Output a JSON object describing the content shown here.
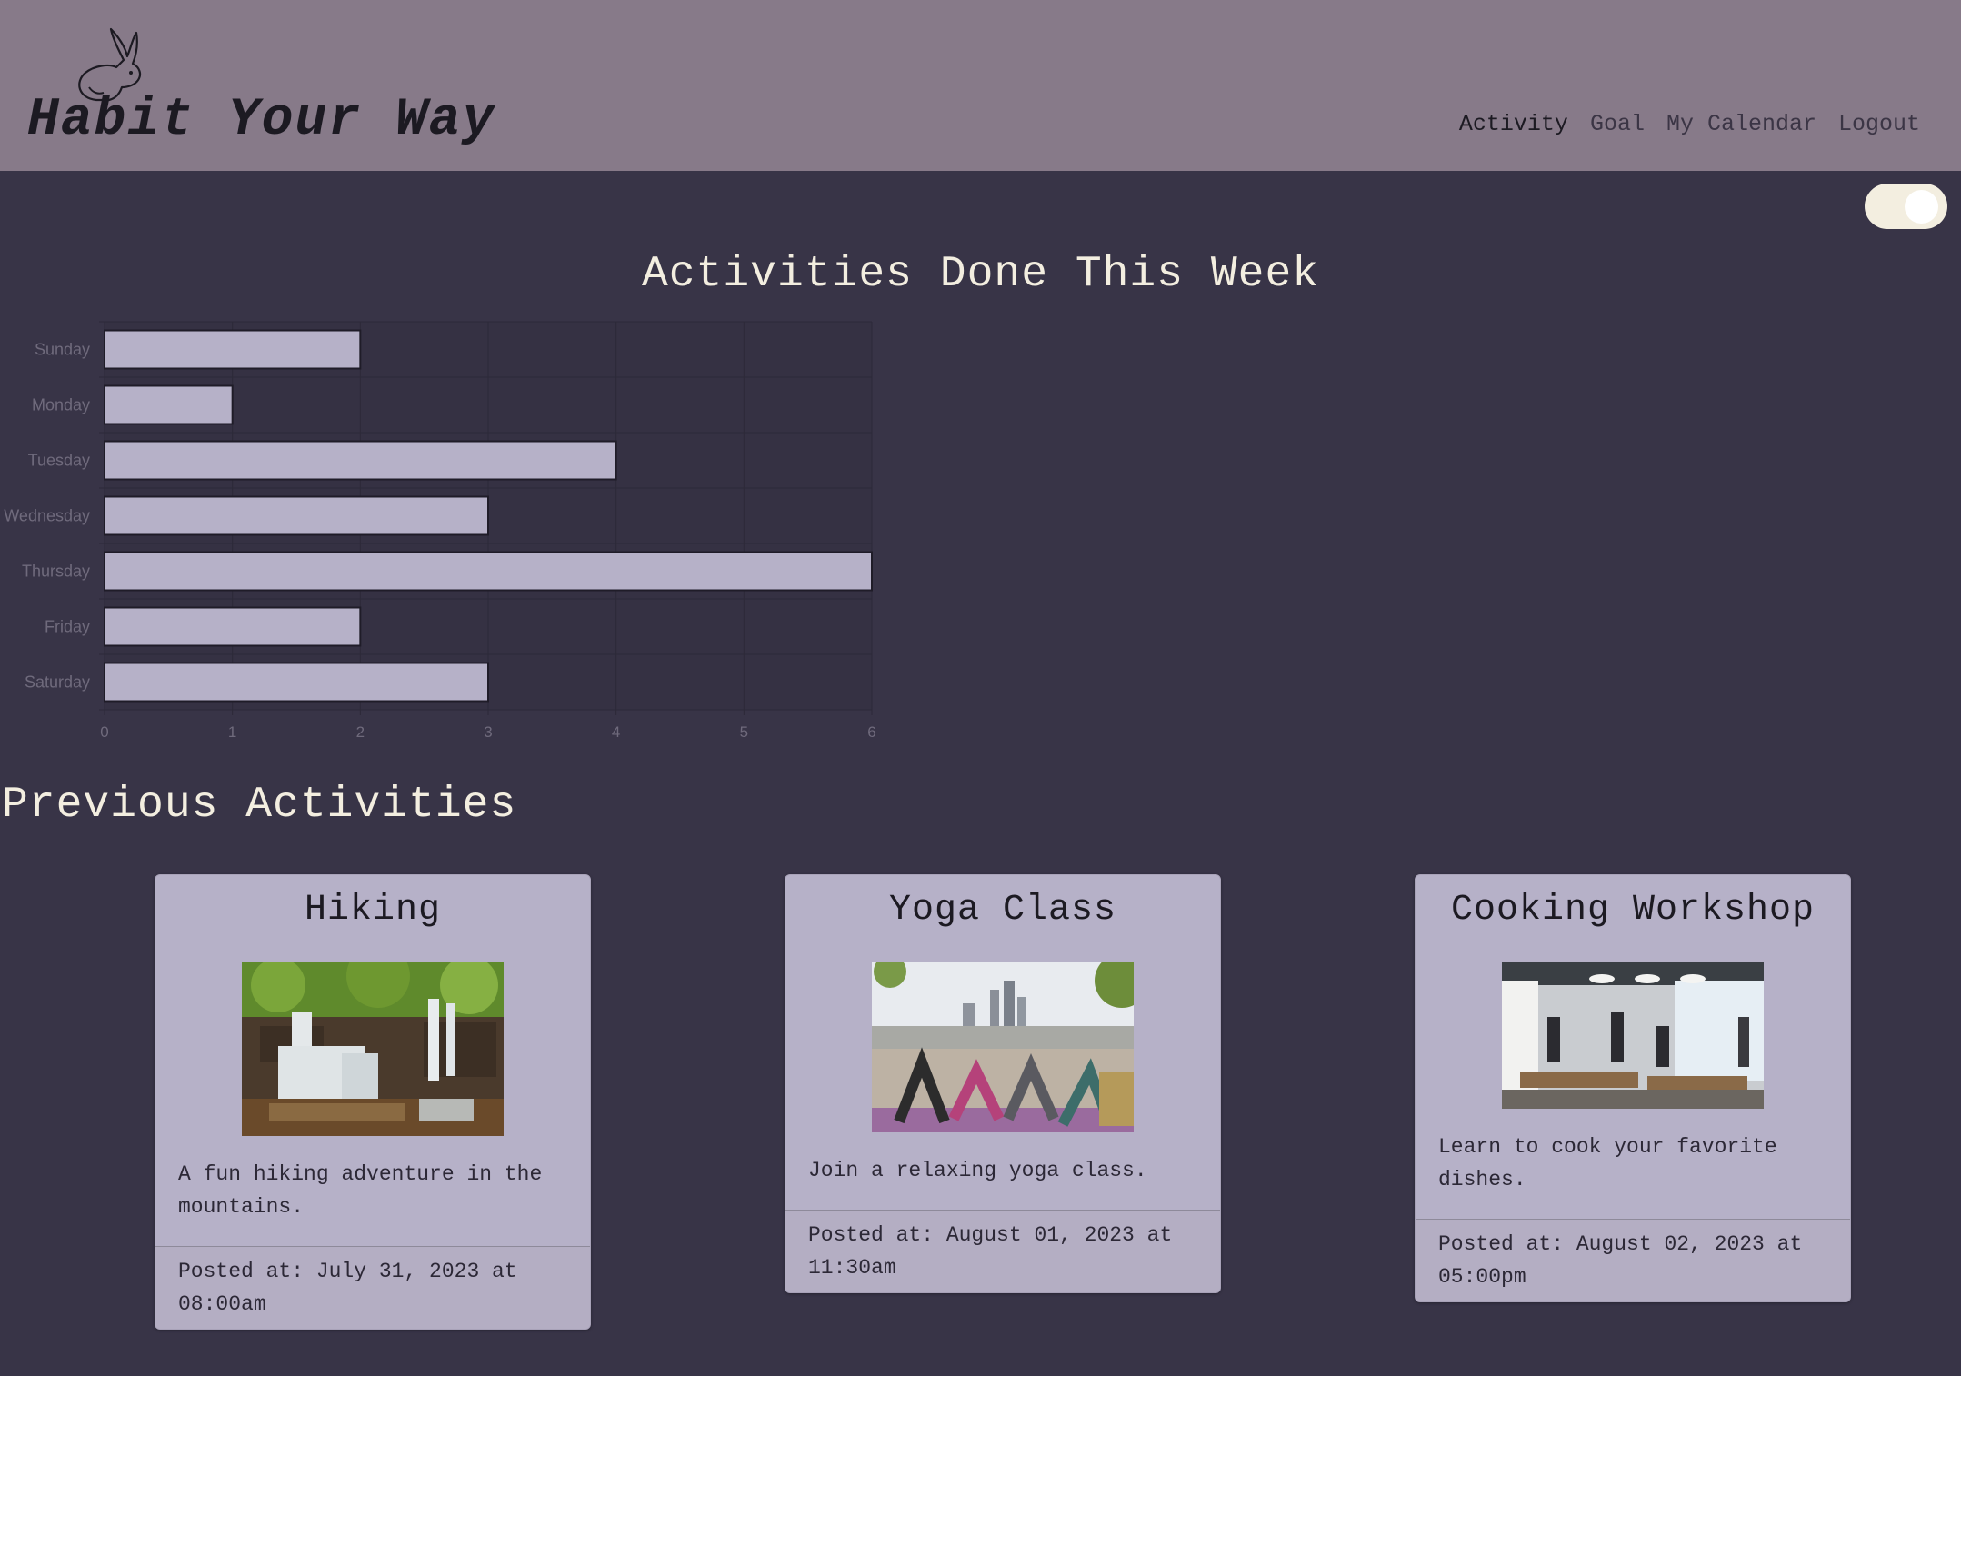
{
  "header": {
    "brand": "Habit Your Way",
    "nav": [
      {
        "label": "Activity"
      },
      {
        "label": "Goal"
      },
      {
        "label": "My Calendar"
      },
      {
        "label": "Logout"
      }
    ]
  },
  "theme_toggle": {
    "state": "on"
  },
  "chart_section": {
    "title": "Activities Done This Week"
  },
  "chart_data": {
    "type": "bar",
    "orientation": "horizontal",
    "categories": [
      "Sunday",
      "Monday",
      "Tuesday",
      "Wednesday",
      "Thursday",
      "Friday",
      "Saturday"
    ],
    "values": [
      2,
      1,
      4,
      3,
      6,
      2,
      3
    ],
    "xlim": [
      0,
      6
    ],
    "x_ticks": [
      0,
      1,
      2,
      3,
      4,
      5,
      6
    ],
    "grid": true,
    "bar_color": "#b6b1c8",
    "title": "",
    "xlabel": "",
    "ylabel": ""
  },
  "previous": {
    "title": "Previous Activities",
    "cards": [
      {
        "title": "Hiking",
        "image": "waterfall-photo",
        "description": "A fun hiking adventure in the mountains.",
        "posted": "Posted at: July 31, 2023 at 08:00am"
      },
      {
        "title": "Yoga Class",
        "image": "rooftop-yoga-photo",
        "description": "Join a relaxing yoga class.",
        "posted": "Posted at: August 01, 2023 at 11:30am"
      },
      {
        "title": "Cooking Workshop",
        "image": "kitchen-workshop-photo",
        "description": "Learn to cook your favorite dishes.",
        "posted": "Posted at: August 02, 2023 at 05:00pm"
      }
    ]
  },
  "colors": {
    "header_bg": "#877a89",
    "page_bg": "#383447",
    "card_bg": "#b6b1c8",
    "accent_text": "#f3eee0"
  }
}
